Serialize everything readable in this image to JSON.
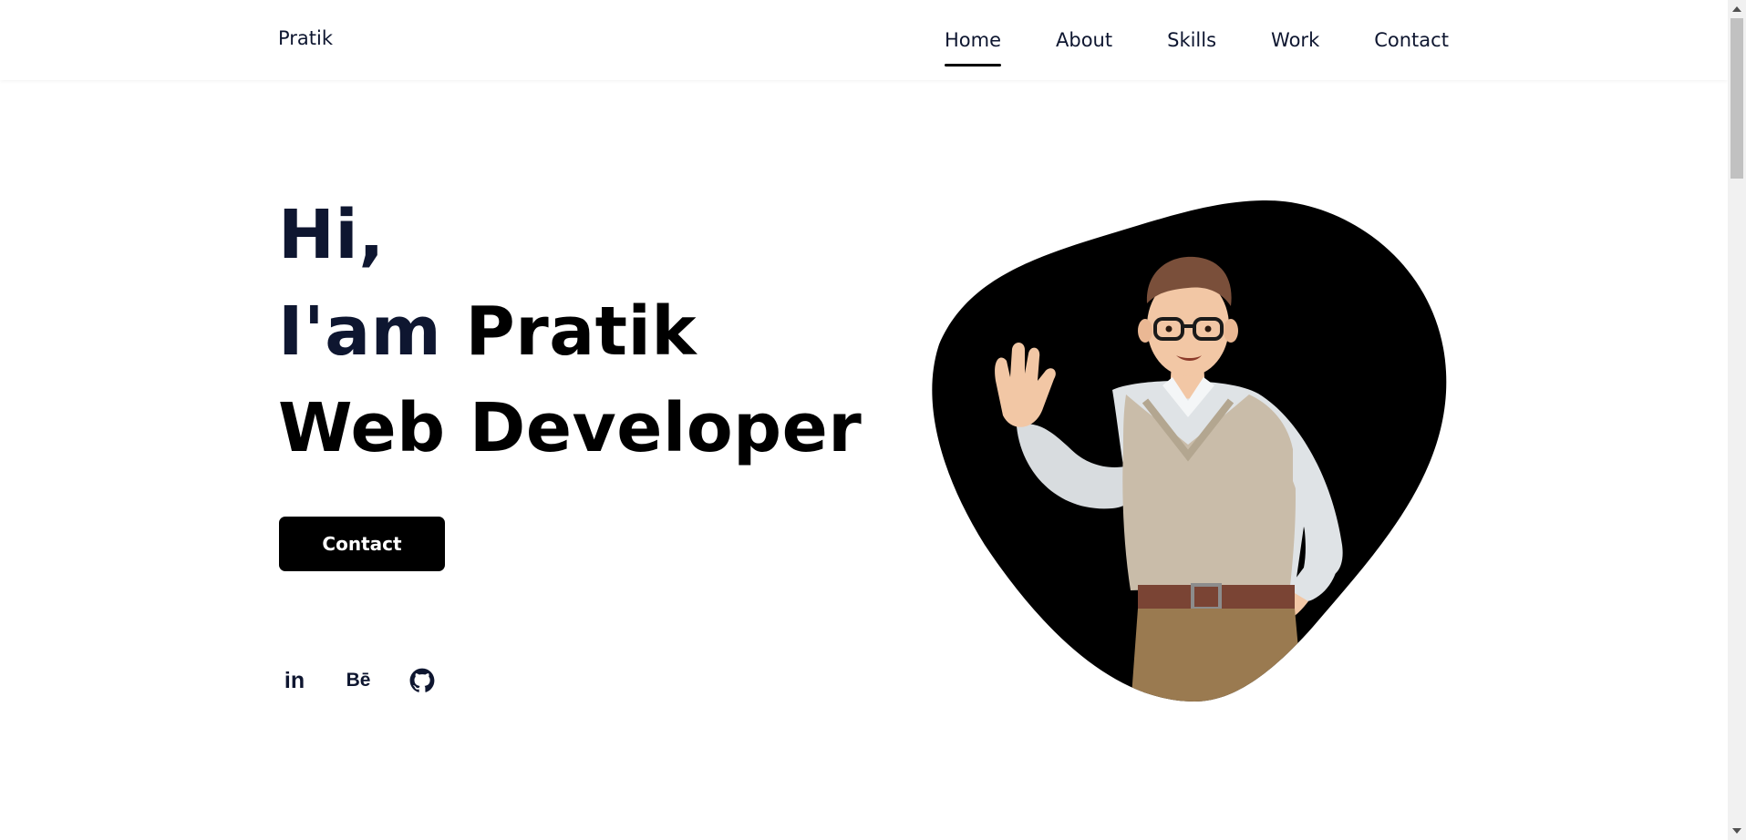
{
  "header": {
    "logo": "Pratik",
    "nav": [
      {
        "label": "Home",
        "active": true
      },
      {
        "label": "About",
        "active": false
      },
      {
        "label": "Skills",
        "active": false
      },
      {
        "label": "Work",
        "active": false
      },
      {
        "label": "Contact",
        "active": false
      }
    ]
  },
  "hero": {
    "greeting": "Hi,",
    "intro_prefix": "I'am",
    "name": "Pratik",
    "role": "Web Developer",
    "button_label": "Contact"
  },
  "socials": [
    {
      "icon": "linkedin-icon",
      "glyph": "in"
    },
    {
      "icon": "behance-icon",
      "glyph": "Bē"
    },
    {
      "icon": "github-icon",
      "glyph": ""
    }
  ],
  "image": {
    "icon": "waving-developer-avatar"
  },
  "colors": {
    "navy": "#0e1630",
    "black": "#000000",
    "white": "#ffffff"
  }
}
